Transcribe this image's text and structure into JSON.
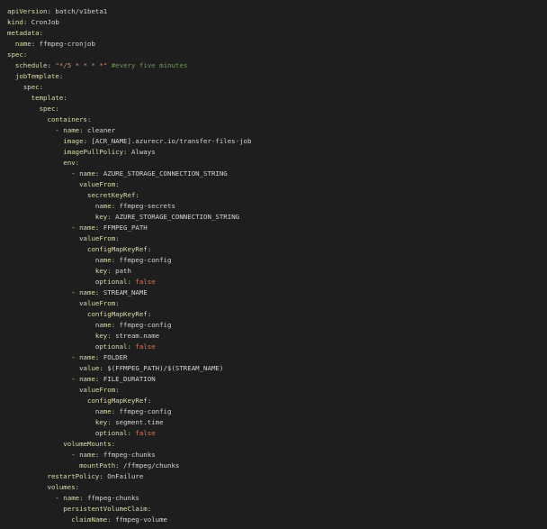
{
  "colors": {
    "background": "#1e1e1e",
    "key": "#dcdcaa",
    "value": "#d4d4d4",
    "string": "#ce9178",
    "comment": "#6a9955",
    "boolean": "#e07b53"
  },
  "lines": [
    {
      "indent": 0,
      "dash": false,
      "key": "apiVersion",
      "value": "batch/v1beta1",
      "vtype": "v"
    },
    {
      "indent": 0,
      "dash": false,
      "key": "kind",
      "value": "CronJob",
      "vtype": "v"
    },
    {
      "indent": 0,
      "dash": false,
      "key": "metadata",
      "value": "",
      "vtype": "v"
    },
    {
      "indent": 2,
      "dash": false,
      "key": "name",
      "value": "ffmpeg-cronjob",
      "vtype": "v"
    },
    {
      "indent": 0,
      "dash": false,
      "key": "spec",
      "value": "",
      "vtype": "v"
    },
    {
      "indent": 2,
      "dash": false,
      "key": "schedule",
      "value": "\"*/5 * * * *\"",
      "vtype": "s",
      "comment": "#every five minutes"
    },
    {
      "indent": 2,
      "dash": false,
      "key": "jobTemplate",
      "value": "",
      "vtype": "v"
    },
    {
      "indent": 4,
      "dash": false,
      "key": "spec",
      "value": "",
      "vtype": "v"
    },
    {
      "indent": 6,
      "dash": false,
      "key": "template",
      "value": "",
      "vtype": "v"
    },
    {
      "indent": 8,
      "dash": false,
      "key": "spec",
      "value": "",
      "vtype": "v"
    },
    {
      "indent": 10,
      "dash": false,
      "key": "containers",
      "value": "",
      "vtype": "v"
    },
    {
      "indent": 12,
      "dash": true,
      "key": "name",
      "value": "cleaner",
      "vtype": "v"
    },
    {
      "indent": 14,
      "dash": false,
      "key": "image",
      "value": "[ACR_NAME].azurecr.io/transfer-files-job",
      "vtype": "v"
    },
    {
      "indent": 14,
      "dash": false,
      "key": "imagePullPolicy",
      "value": "Always",
      "vtype": "v"
    },
    {
      "indent": 14,
      "dash": false,
      "key": "env",
      "value": "",
      "vtype": "v"
    },
    {
      "indent": 16,
      "dash": true,
      "key": "name",
      "value": "AZURE_STORAGE_CONNECTION_STRING",
      "vtype": "v"
    },
    {
      "indent": 18,
      "dash": false,
      "key": "valueFrom",
      "value": "",
      "vtype": "v"
    },
    {
      "indent": 20,
      "dash": false,
      "key": "secretKeyRef",
      "value": "",
      "vtype": "v"
    },
    {
      "indent": 22,
      "dash": false,
      "key": "name",
      "value": "ffmpeg-secrets",
      "vtype": "v"
    },
    {
      "indent": 22,
      "dash": false,
      "key": "key",
      "value": "AZURE_STORAGE_CONNECTION_STRING",
      "vtype": "v"
    },
    {
      "indent": 16,
      "dash": true,
      "key": "name",
      "value": "FFMPEG_PATH",
      "vtype": "v"
    },
    {
      "indent": 18,
      "dash": false,
      "key": "valueFrom",
      "value": "",
      "vtype": "v"
    },
    {
      "indent": 20,
      "dash": false,
      "key": "configMapKeyRef",
      "value": "",
      "vtype": "v"
    },
    {
      "indent": 22,
      "dash": false,
      "key": "name",
      "value": "ffmpeg-config",
      "vtype": "v"
    },
    {
      "indent": 22,
      "dash": false,
      "key": "key",
      "value": "path",
      "vtype": "v"
    },
    {
      "indent": 22,
      "dash": false,
      "key": "optional",
      "value": "false",
      "vtype": "b"
    },
    {
      "indent": 16,
      "dash": true,
      "key": "name",
      "value": "STREAM_NAME",
      "vtype": "v"
    },
    {
      "indent": 18,
      "dash": false,
      "key": "valueFrom",
      "value": "",
      "vtype": "v"
    },
    {
      "indent": 20,
      "dash": false,
      "key": "configMapKeyRef",
      "value": "",
      "vtype": "v"
    },
    {
      "indent": 22,
      "dash": false,
      "key": "name",
      "value": "ffmpeg-config",
      "vtype": "v"
    },
    {
      "indent": 22,
      "dash": false,
      "key": "key",
      "value": "stream.name",
      "vtype": "v"
    },
    {
      "indent": 22,
      "dash": false,
      "key": "optional",
      "value": "false",
      "vtype": "b"
    },
    {
      "indent": 16,
      "dash": true,
      "key": "name",
      "value": "FOLDER",
      "vtype": "v"
    },
    {
      "indent": 18,
      "dash": false,
      "key": "value",
      "value": "$(FFMPEG_PATH)/$(STREAM_NAME)",
      "vtype": "v"
    },
    {
      "indent": 16,
      "dash": true,
      "key": "name",
      "value": "FILE_DURATION",
      "vtype": "v"
    },
    {
      "indent": 18,
      "dash": false,
      "key": "valueFrom",
      "value": "",
      "vtype": "v"
    },
    {
      "indent": 20,
      "dash": false,
      "key": "configMapKeyRef",
      "value": "",
      "vtype": "v"
    },
    {
      "indent": 22,
      "dash": false,
      "key": "name",
      "value": "ffmpeg-config",
      "vtype": "v"
    },
    {
      "indent": 22,
      "dash": false,
      "key": "key",
      "value": "segment.time",
      "vtype": "v"
    },
    {
      "indent": 22,
      "dash": false,
      "key": "optional",
      "value": "false",
      "vtype": "b"
    },
    {
      "indent": 14,
      "dash": false,
      "key": "volumeMounts",
      "value": "",
      "vtype": "v"
    },
    {
      "indent": 16,
      "dash": true,
      "key": "name",
      "value": "ffmpeg-chunks",
      "vtype": "v"
    },
    {
      "indent": 18,
      "dash": false,
      "key": "mountPath",
      "value": "/ffmpeg/chunks",
      "vtype": "v"
    },
    {
      "indent": 10,
      "dash": false,
      "key": "restartPolicy",
      "value": "OnFailure",
      "vtype": "v"
    },
    {
      "indent": 10,
      "dash": false,
      "key": "volumes",
      "value": "",
      "vtype": "v"
    },
    {
      "indent": 12,
      "dash": true,
      "key": "name",
      "value": "ffmpeg-chunks",
      "vtype": "v"
    },
    {
      "indent": 14,
      "dash": false,
      "key": "persistentVolumeClaim",
      "value": "",
      "vtype": "v"
    },
    {
      "indent": 16,
      "dash": false,
      "key": "claimName",
      "value": "ffmpeg-volume",
      "vtype": "v"
    }
  ]
}
